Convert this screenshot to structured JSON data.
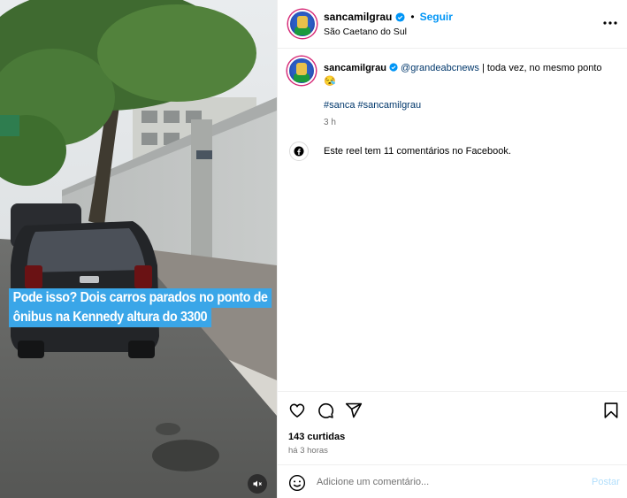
{
  "reel": {
    "caption_line1": "Pode isso? Dois carros parados no ponto de",
    "caption_line2": "ônibus na Kennedy altura do 3300",
    "mute_icon": "speaker-muted-icon"
  },
  "header": {
    "username": "sancamilgrau",
    "separator": "•",
    "follow_label": "Seguir",
    "location": "São Caetano do Sul",
    "more_icon": "three-dots-icon"
  },
  "comment": {
    "username": "sancamilgrau",
    "mention": "@grandeabcnews",
    "text": " | toda vez, no mesmo ponto",
    "emoji": "😪",
    "hashtag1": "#sanca",
    "hashtag2": "#sancamilgrau",
    "time": "3 h"
  },
  "facebook": {
    "icon": "facebook-icon",
    "text": "Este reel tem 11 comentários no Facebook."
  },
  "actions": {
    "like_icon": "heart-icon",
    "comment_icon": "comment-bubble-icon",
    "share_icon": "paper-plane-icon",
    "save_icon": "bookmark-icon",
    "likes": "143 curtidas",
    "posted": "há 3 horas"
  },
  "add_comment": {
    "emoji_icon": "smiley-icon",
    "placeholder": "Adicione um comentário...",
    "post_label": "Postar"
  },
  "colors": {
    "accent": "#0095f6",
    "caption_bg": "#3aa6e8",
    "mention": "#00376b",
    "muted_text": "#737373",
    "post_disabled": "#b2dffc"
  }
}
